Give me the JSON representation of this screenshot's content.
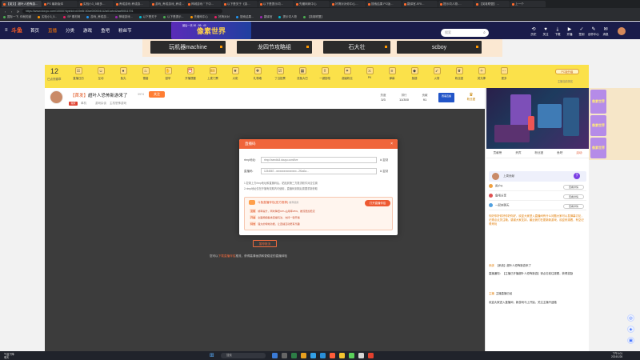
{
  "browser": {
    "tabs": [
      "【英文】超叶人恐怖游…",
      "PS 最新版本",
      "实验小3_5网多…",
      "养成游戏 养成游…",
      "游戏_养成游戏_养成…",
      "神城游戏 \" 下中…",
      "以下是关于《游…",
      "以下是提示词…",
      "先暖网网中心",
      "好搞对对你中心…",
      "搜索结果 PC版…",
      "翻译官-ERI…",
      "提示词人物-…",
      "【英雄联盟】…",
      "上一个"
    ],
    "url": "https://www.douyu.com/10000?dyshid=d19e8f-50ce000004112a01ofc42aa90011701",
    "bookmarks": [
      "国际一下, 你就知道",
      "实验小3_5...",
      "SP 素材网",
      "游戏_养成游...",
      "神城游戏...",
      "以下是关于",
      "以下是提示...",
      "先暖网中心",
      "好搞对对",
      "搜索结果...",
      "翻译官",
      "提示词人物",
      "【英雄联盟】"
    ]
  },
  "header": {
    "logo": "斗鱼",
    "nav": [
      "首页",
      "直播",
      "分类",
      "游戏",
      "鱼吧",
      "粉丝节"
    ],
    "nav_current": 1,
    "promo_text": "像素世界",
    "promo_small": "最后一天 00 : 59 : 40",
    "search_placeholder": "搜索",
    "icons": [
      {
        "label": "历史",
        "icon": "history-icon"
      },
      {
        "label": "关注",
        "icon": "follow-icon"
      },
      {
        "label": "下载",
        "icon": "download-icon"
      },
      {
        "label": "开播",
        "icon": "live-icon"
      },
      {
        "label": "签到",
        "icon": "checkin-icon"
      },
      {
        "label": "创作中心",
        "icon": "creator-icon"
      },
      {
        "label": "消息",
        "icon": "message-icon"
      }
    ]
  },
  "banner_tags": [
    "玩机器machine",
    "龙四节攻略组",
    "石大壮",
    "scboy"
  ],
  "room_bar": {
    "count": "12",
    "count_label": "已点亮徽章",
    "gifts": [
      "直播日历",
      "互动",
      "鱼丸",
      "雪碧",
      "鼓掌",
      "开播提醒",
      "上麦门票",
      "大佬",
      "礼物墙",
      "丁当投票",
      "逗鱼大巴",
      "一键投喂",
      "超级粉丝",
      "PK",
      "弹幕",
      "鱼翅",
      "火箭",
      "粉丝团",
      "荧光棒",
      "更多"
    ],
    "rank_button": "PC版升级",
    "rank_sub": "主播当前排名"
  },
  "stream": {
    "title_tag": "【首发】",
    "title": "超叶人恐怖新游来了",
    "views": "3974",
    "follow_label": "关注",
    "badge": "独家",
    "sub": [
      "单机",
      "游戏杂谈",
      "主机恐怖游戏"
    ],
    "stats": [
      {
        "label": "热度",
        "value": "3/3"
      },
      {
        "label": "排行",
        "value": "11/300"
      },
      {
        "label": "贡献",
        "value": "91"
      }
    ],
    "ad_button": "赛事直播",
    "fans_label": "粉丝团"
  },
  "dialog": {
    "title": "直播码",
    "rtmp_label": "rtmp地址:",
    "rtmp_value": "rtmp://sendtc3.douyu.com/live",
    "key_label": "直播码:",
    "key_value": "1234567...xxxxxxxxxxxxxxxx...2f1a0a...",
    "copy_label": "复制",
    "notes": [
      "1.复制上方rtmp地址和直播码后，粘贴到第三方推流软件对应位置",
      "2.rtmp地址仅在开播有效期内可使用，直播码到期后需要重新获取"
    ],
    "warn_title": "斗鱼直播伴侣(官方推荐)",
    "warn_title_tag": "推荐使用",
    "warn_button": "打开直播伴侣",
    "warn_lines": [
      {
        "tag": "流畅",
        "text": "帧率提升，同时降低CPU占用率25%，推流更加稳定"
      },
      {
        "tag": "开播",
        "text": "全面拥抱各类直播玩法，支持一键开播"
      },
      {
        "tag": "特效",
        "text": "强大的特效功能，让直播互动更有乐趣"
      }
    ]
  },
  "player": {
    "button": "暂停推流",
    "tip_prefix": "您可以",
    "tip_link": "下载直播伴侣",
    "tip_suffix": "推流，获得高清画质和更稳定的直播体验"
  },
  "right_panel": {
    "tabs": [
      "贡献榜",
      "贵宾",
      "粉丝团",
      "鱼吧",
      "活动"
    ],
    "tab_current": 4,
    "card_text": "上周贡献",
    "rows": [
      "用户A",
      "鱼吧分享",
      "一起来聊天"
    ],
    "row_button": "查看详情",
    "chat": [
      {
        "prefix": "",
        "text": "你好你好你好你好你好，欢迎大家进入直播间有什么问题大家可以发弹幕讨论，记得点点关注哦，感谢大家支持，最近我们在更新新游戏，欢迎来观看，有空记得来玩"
      },
      {
        "prefix": "系统",
        "text": "【系统】超叶人恐怖新游来了"
      },
      {
        "prefix": "",
        "text": "直播通知：【主播已开播超叶人恐怖新游】请点击前往观看，获得奖励"
      },
      {
        "prefix": "主播",
        "text": "主播直播已经"
      },
      {
        "prefix": "",
        "text": "欢迎大家进入直播间，新游戏马上开始，关注主播不迷路"
      }
    ]
  },
  "ads": [
    "像素世界",
    "像素世界",
    "像素世界"
  ],
  "taskbar": {
    "weather": "气温下降",
    "weather_sub": "明天",
    "search_placeholder": "搜索",
    "time": "下午4:01",
    "date": "2024/1/26"
  }
}
